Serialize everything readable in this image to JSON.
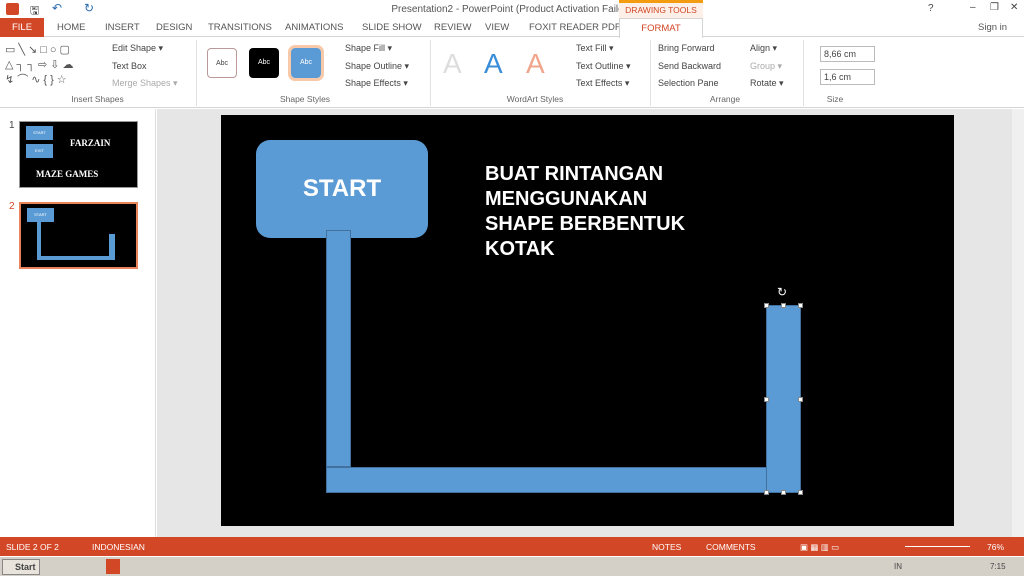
{
  "window": {
    "title": "Presentation2 - PowerPoint (Product Activation Failed)",
    "sign_in": "Sign in",
    "help": "?",
    "minimize": "–",
    "restore": "❐",
    "close": "✕"
  },
  "context_tab": "DRAWING TOOLS",
  "tabs": [
    "FILE",
    "HOME",
    "INSERT",
    "DESIGN",
    "TRANSITIONS",
    "ANIMATIONS",
    "SLIDE SHOW",
    "REVIEW",
    "VIEW",
    "FOXIT READER PDF",
    "FORMAT"
  ],
  "ribbon": {
    "insert_shapes": {
      "label": "Insert Shapes",
      "edit_shape": "Edit Shape ▾",
      "text_box": "Text Box",
      "merge_shapes": "Merge Shapes ▾"
    },
    "shape_styles": {
      "label": "Shape Styles",
      "style_sample": "Abc",
      "shape_fill": "Shape Fill ▾",
      "shape_outline": "Shape Outline ▾",
      "shape_effects": "Shape Effects ▾"
    },
    "wordart": {
      "label": "WordArt Styles",
      "sample": "A",
      "text_fill": "Text Fill ▾",
      "text_outline": "Text Outline ▾",
      "text_effects": "Text Effects ▾"
    },
    "arrange": {
      "label": "Arrange",
      "bring_forward": "Bring Forward",
      "send_backward": "Send Backward",
      "selection_pane": "Selection Pane",
      "align": "Align ▾",
      "group": "Group ▾",
      "rotate": "Rotate ▾"
    },
    "size": {
      "label": "Size",
      "height": "8,66 cm",
      "width": "1,6 cm"
    }
  },
  "slides": [
    {
      "number": "1",
      "start": "START",
      "exit": "EXIT",
      "title": "FARZAIN",
      "subtitle": "MAZE GAMES"
    },
    {
      "number": "2",
      "start": "START"
    }
  ],
  "slide": {
    "start_label": "START",
    "text": "BUAT RINTANGAN\nMENGGUNAKAN\nSHAPE BERBENTUK\nKOTAK"
  },
  "status": {
    "slide": "SLIDE 2 OF 2",
    "language": "INDONESIAN",
    "notes": "NOTES",
    "comments": "COMMENTS",
    "zoom": "76%"
  },
  "taskbar": {
    "start": "Start",
    "lang": "IN",
    "time": "7:15"
  },
  "colors": {
    "accent": "#d24726",
    "shape": "#5b9bd5"
  }
}
